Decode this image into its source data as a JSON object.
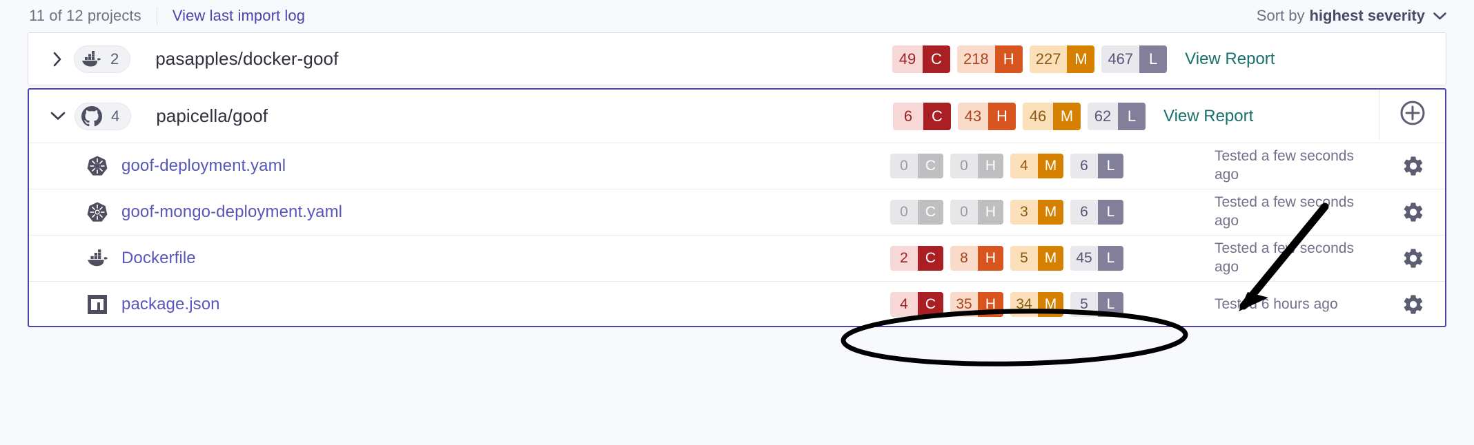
{
  "header": {
    "project_count": "11 of 12 projects",
    "import_log_link": "View last import log",
    "sort_label": "Sort by",
    "sort_value": "highest severity",
    "chevron_icon": "chevron-down-icon"
  },
  "colors": {
    "critical_bg": "#f8d7d7",
    "critical_letter_bg": "#a91f23",
    "critical_text": "#9b2226",
    "high_bg": "#fadbc9",
    "high_letter_bg": "#d8551f",
    "high_text": "#a8441c",
    "medium_bg": "#fbdfb8",
    "medium_letter_bg": "#d68000",
    "medium_text": "#8a5a10",
    "low_bg": "#e9e9ed",
    "low_letter_bg": "#817f9a",
    "low_text": "#56567a",
    "zero_bg": "#e7e7e9",
    "zero_letter_bg": "#bfbfc2",
    "zero_text": "#9a9aa0",
    "link": "#5856b8",
    "report_link": "#18706e",
    "selected_border": "#4b45ab"
  },
  "projects": [
    {
      "expanded": false,
      "caret_icon": "chevron-right-icon",
      "source_icon": "docker-icon",
      "target_count": "2",
      "name": "pasapples/docker-goof",
      "severities": [
        {
          "count": "49",
          "letter": "C",
          "level": "critical"
        },
        {
          "count": "218",
          "letter": "H",
          "level": "high"
        },
        {
          "count": "227",
          "letter": "M",
          "level": "medium"
        },
        {
          "count": "467",
          "letter": "L",
          "level": "low"
        }
      ],
      "view_report": "View Report",
      "files": []
    },
    {
      "expanded": true,
      "caret_icon": "chevron-down-icon",
      "source_icon": "github-icon",
      "target_count": "4",
      "name": "papicella/goof",
      "severities": [
        {
          "count": "6",
          "letter": "C",
          "level": "critical"
        },
        {
          "count": "43",
          "letter": "H",
          "level": "high"
        },
        {
          "count": "46",
          "letter": "M",
          "level": "medium"
        },
        {
          "count": "62",
          "letter": "L",
          "level": "low"
        }
      ],
      "view_report": "View Report",
      "add_button_icon": "plus-circle-icon",
      "files": [
        {
          "icon": "kubernetes-icon",
          "name": "goof-deployment.yaml",
          "severities": [
            {
              "count": "0",
              "letter": "C",
              "level": "zero"
            },
            {
              "count": "0",
              "letter": "H",
              "level": "zero"
            },
            {
              "count": "4",
              "letter": "M",
              "level": "medium"
            },
            {
              "count": "6",
              "letter": "L",
              "level": "low"
            }
          ],
          "tested": "Tested a few seconds ago",
          "settings_icon": "gear-icon"
        },
        {
          "icon": "kubernetes-icon",
          "name": "goof-mongo-deployment.yaml",
          "severities": [
            {
              "count": "0",
              "letter": "C",
              "level": "zero"
            },
            {
              "count": "0",
              "letter": "H",
              "level": "zero"
            },
            {
              "count": "3",
              "letter": "M",
              "level": "medium"
            },
            {
              "count": "6",
              "letter": "L",
              "level": "low"
            }
          ],
          "tested": "Tested a few seconds ago",
          "settings_icon": "gear-icon"
        },
        {
          "icon": "docker-icon",
          "name": "Dockerfile",
          "severities": [
            {
              "count": "2",
              "letter": "C",
              "level": "critical"
            },
            {
              "count": "8",
              "letter": "H",
              "level": "high"
            },
            {
              "count": "5",
              "letter": "M",
              "level": "medium"
            },
            {
              "count": "45",
              "letter": "L",
              "level": "low"
            }
          ],
          "tested": "Tested a few seconds ago",
          "settings_icon": "gear-icon",
          "highlighted": true
        },
        {
          "icon": "npm-icon",
          "name": "package.json",
          "severities": [
            {
              "count": "4",
              "letter": "C",
              "level": "critical"
            },
            {
              "count": "35",
              "letter": "H",
              "level": "high"
            },
            {
              "count": "34",
              "letter": "M",
              "level": "medium"
            },
            {
              "count": "5",
              "letter": "L",
              "level": "low"
            }
          ],
          "tested": "Tested 6 hours ago",
          "settings_icon": "gear-icon"
        }
      ]
    }
  ],
  "annotations": {
    "ellipse": "hand-drawn-ellipse-around-dockerfile-severities",
    "arrow": "hand-drawn-arrow-pointing-to-dockerfile-row"
  }
}
